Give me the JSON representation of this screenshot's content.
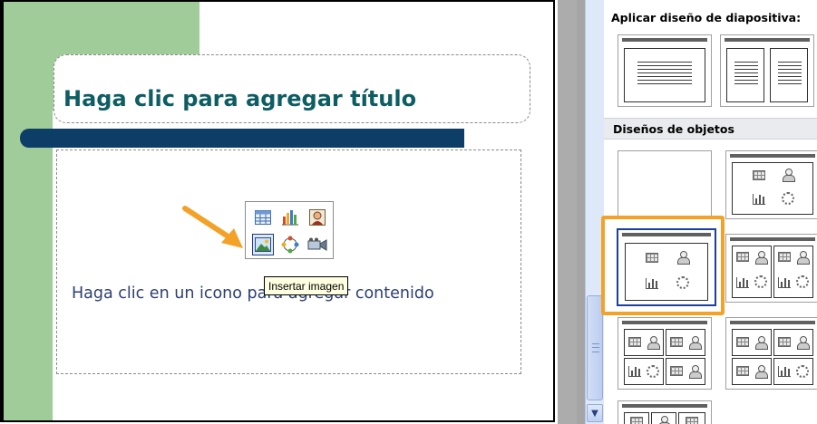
{
  "slide": {
    "title_placeholder": "Haga clic para agregar título",
    "content_placeholder": "Haga clic en un icono para agregar contenido",
    "tooltip": "Insertar imagen",
    "palette_icons": [
      "table-icon",
      "chart-icon",
      "clipart-icon",
      "picture-icon",
      "diagram-icon",
      "media-clip-icon"
    ],
    "accent_colors": {
      "green": "#9fcc98",
      "navy_bar": "#0d3e68",
      "title_text": "#0e5d63",
      "highlight": "#f4a128"
    }
  },
  "task_pane": {
    "apply_layout_header": "Aplicar diseño de diapositiva:",
    "objects_section_header": "Diseños de objetos"
  }
}
